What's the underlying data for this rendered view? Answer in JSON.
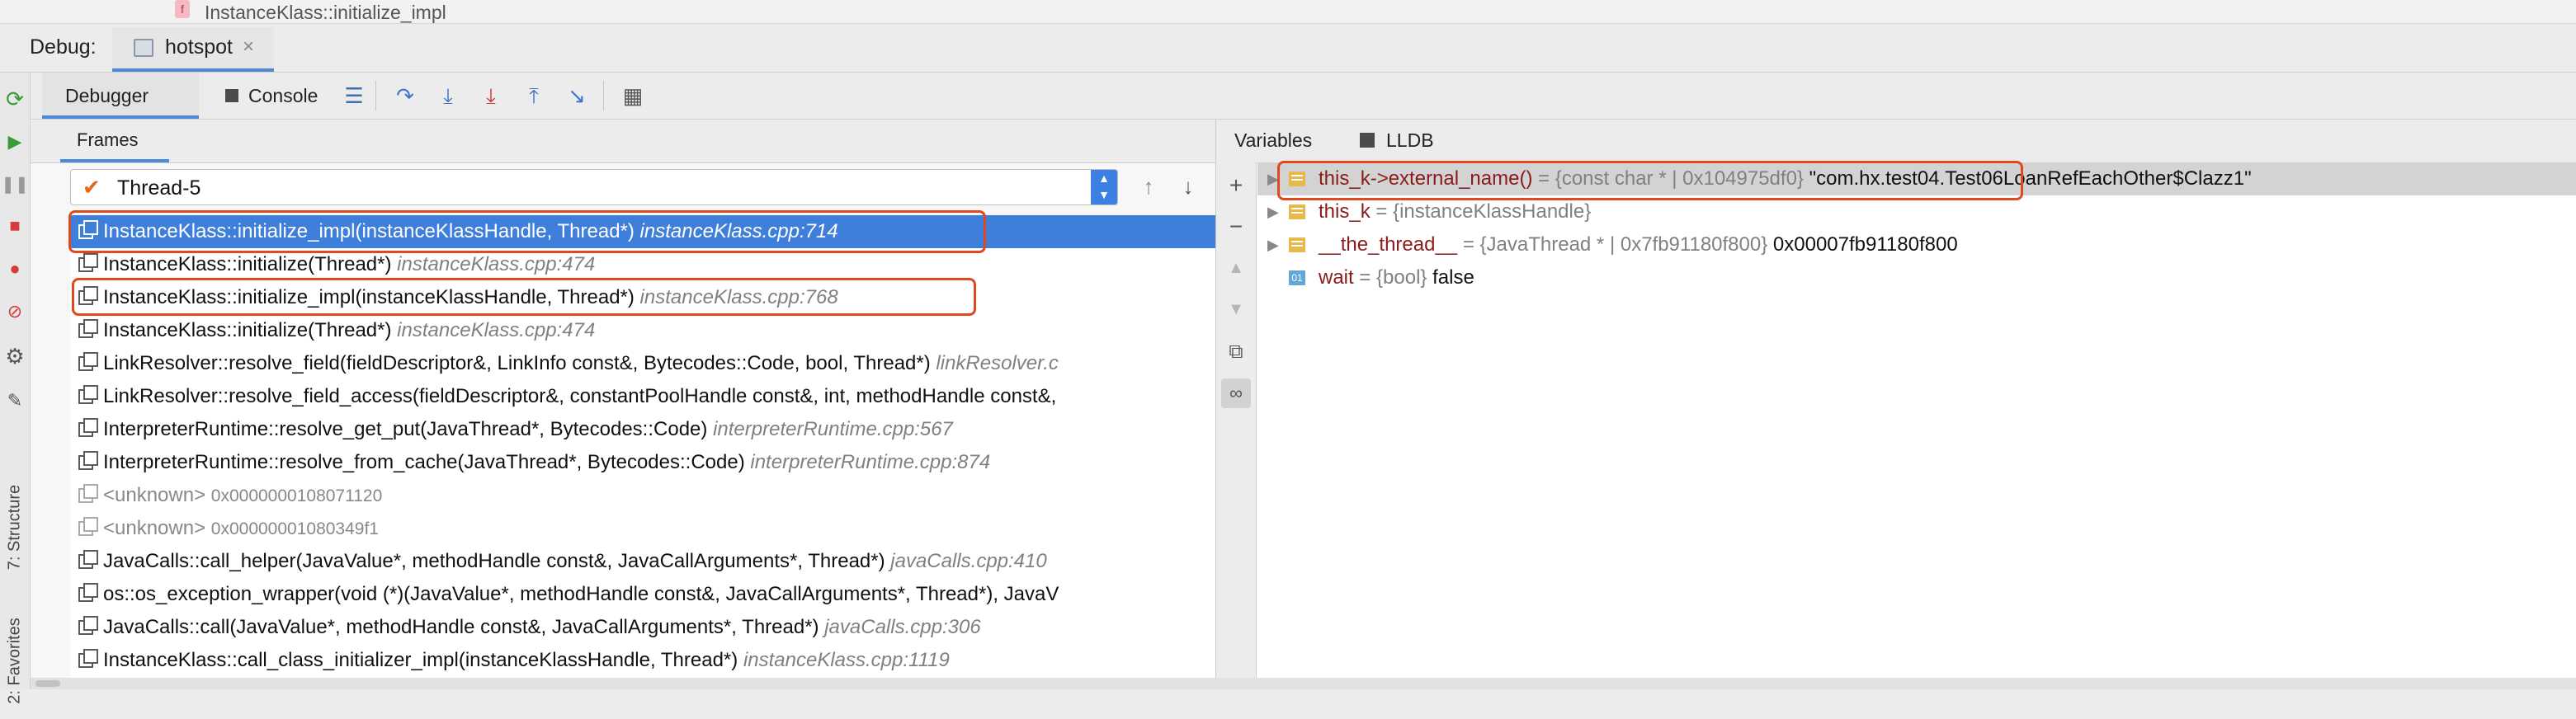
{
  "breadcrumb": {
    "icon_letter": "f",
    "text": "InstanceKlass::initialize_impl"
  },
  "debug_bar": {
    "label": "Debug:",
    "session_tab": "hotspot",
    "close_glyph": "×"
  },
  "sidebar": {
    "structure_label": "7: Structure",
    "favorites_label": "2: Favorites"
  },
  "toolbar": {
    "debugger_tab": "Debugger",
    "console_tab": "Console"
  },
  "frames": {
    "tab_label": "Frames",
    "thread": "Thread-5",
    "items": [
      {
        "name": "InstanceKlass::initialize_impl(instanceKlassHandle, Thread*)",
        "loc": "instanceKlass.cpp:714"
      },
      {
        "name": "InstanceKlass::initialize(Thread*)",
        "loc": "instanceKlass.cpp:474"
      },
      {
        "name": "InstanceKlass::initialize_impl(instanceKlassHandle, Thread*)",
        "loc": "instanceKlass.cpp:768"
      },
      {
        "name": "InstanceKlass::initialize(Thread*)",
        "loc": "instanceKlass.cpp:474"
      },
      {
        "name": "LinkResolver::resolve_field(fieldDescriptor&, LinkInfo const&, Bytecodes::Code, bool, Thread*)",
        "loc": "linkResolver.c"
      },
      {
        "name": "LinkResolver::resolve_field_access(fieldDescriptor&, constantPoolHandle const&, int, methodHandle const&,",
        "loc": ""
      },
      {
        "name": "InterpreterRuntime::resolve_get_put(JavaThread*, Bytecodes::Code)",
        "loc": "interpreterRuntime.cpp:567"
      },
      {
        "name": "InterpreterRuntime::resolve_from_cache(JavaThread*, Bytecodes::Code)",
        "loc": "interpreterRuntime.cpp:874"
      },
      {
        "name": "<unknown>",
        "loc": "0x0000000108071120"
      },
      {
        "name": "<unknown>",
        "loc": "0x00000001080349f1"
      },
      {
        "name": "JavaCalls::call_helper(JavaValue*, methodHandle const&, JavaCallArguments*, Thread*)",
        "loc": "javaCalls.cpp:410"
      },
      {
        "name": "os::os_exception_wrapper(void (*)(JavaValue*, methodHandle const&, JavaCallArguments*, Thread*), JavaV",
        "loc": ""
      },
      {
        "name": "JavaCalls::call(JavaValue*, methodHandle const&, JavaCallArguments*, Thread*)",
        "loc": "javaCalls.cpp:306"
      },
      {
        "name": "InstanceKlass::call_class_initializer_impl(instanceKlassHandle, Thread*)",
        "loc": "instanceKlass.cpp:1119"
      }
    ]
  },
  "variables": {
    "tab_label": "Variables",
    "lldb_label": "LLDB",
    "items": [
      {
        "name": "this_k->external_name()",
        "type": " = {const char * | 0x104975df0}",
        "value": " \"com.hx.test04.Test06LoanRefEachOther$Clazz1\""
      },
      {
        "name": "this_k",
        "type": " = {instanceKlassHandle}",
        "value": ""
      },
      {
        "name": "__the_thread__",
        "type": " = {JavaThread * | 0x7fb91180f800}",
        "value": " 0x00007fb91180f800"
      },
      {
        "name": "wait",
        "type": " = {bool}",
        "value": " false"
      }
    ],
    "prim_badge": "01"
  },
  "colors": {
    "selection": "#3f7fdc",
    "highlight_box": "#e0491e",
    "accent": "#4a8ad8"
  }
}
